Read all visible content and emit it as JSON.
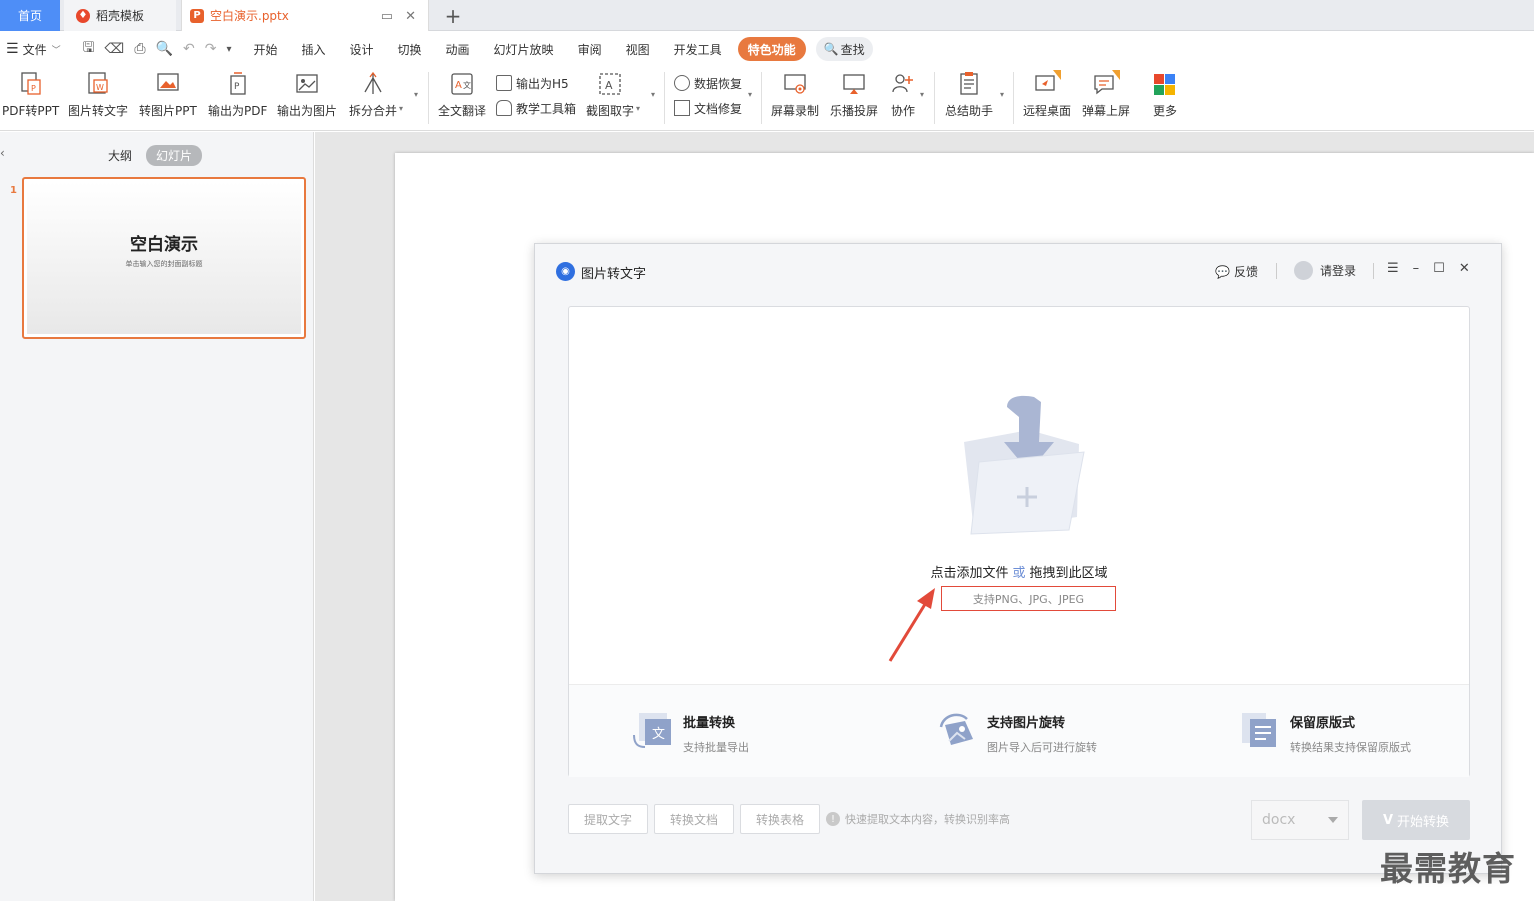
{
  "tabs": {
    "home": "首页",
    "template": "稻壳模板",
    "doc": "空白演示.pptx"
  },
  "menu": {
    "file": "文件",
    "items": [
      "开始",
      "插入",
      "设计",
      "切换",
      "动画",
      "幻灯片放映",
      "审阅",
      "视图",
      "开发工具"
    ],
    "special": "特色功能",
    "find": "查找"
  },
  "ribbon": {
    "pdf2ppt": "PDF转PPT",
    "img2text": "图片转文字",
    "img2ppt": "转图片PPT",
    "export_pdf": "输出为PDF",
    "export_img": "输出为图片",
    "split_merge": "拆分合并",
    "translate": "全文翻译",
    "export_h5": "输出为H5",
    "teach_tools": "教学工具箱",
    "screenshot_ocr": "截图取字",
    "data_recovery": "数据恢复",
    "doc_repair": "文档修复",
    "screen_record": "屏幕录制",
    "cast": "乐播投屏",
    "collab": "协作",
    "summary": "总结助手",
    "remote": "远程桌面",
    "danmaku": "弹幕上屏",
    "more": "更多",
    "badge": "特"
  },
  "leftpanel": {
    "outline": "大纲",
    "slides": "幻灯片",
    "slide_number": "1",
    "thumb_title": "空白演示",
    "thumb_subtitle": "单击输入您的封面副标题"
  },
  "dialog": {
    "title": "图片转文字",
    "feedback": "反馈",
    "login": "请登录",
    "drop_main": "点击添加文件",
    "drop_or": "或",
    "drop_drag": "拖拽到此区域",
    "formats": "支持PNG、JPG、JPEG",
    "features": [
      {
        "title": "批量转换",
        "desc": "支持批量导出"
      },
      {
        "title": "支持图片旋转",
        "desc": "图片导入后可进行旋转"
      },
      {
        "title": "保留原版式",
        "desc": "转换结果支持保留原版式"
      }
    ],
    "btn_extract": "提取文字",
    "btn_doc": "转换文档",
    "btn_table": "转换表格",
    "hint": "快速提取文本内容，转换识别率高",
    "format_value": "docx",
    "start": "开始转换"
  },
  "watermark": "最需教育",
  "colors": {
    "accent": "#e8793f",
    "tab_home": "#4e8ef7",
    "dialog_logo": "#2f6fe0",
    "annotation": "#e24a3a"
  }
}
